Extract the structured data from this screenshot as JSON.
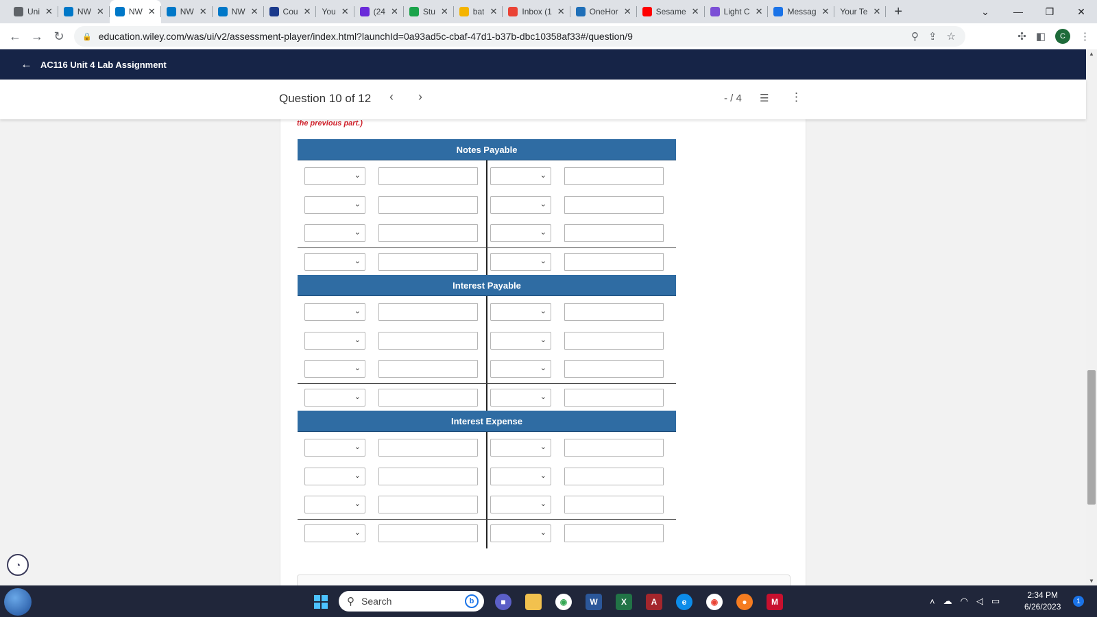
{
  "browser": {
    "tabs": [
      {
        "title": "Uni",
        "icon": "university-icon",
        "color": "#5f6368"
      },
      {
        "title": "NW",
        "icon": "wiley-plus-icon",
        "color": "#0078c8"
      },
      {
        "title": "NW",
        "icon": "wiley-plus-icon",
        "color": "#0078c8",
        "active": true
      },
      {
        "title": "NW",
        "icon": "wiley-plus-icon",
        "color": "#0078c8"
      },
      {
        "title": "NW",
        "icon": "wiley-plus-icon",
        "color": "#0078c8"
      },
      {
        "title": "Cou",
        "icon": "star-shield-icon",
        "color": "#1b3a8c"
      },
      {
        "title": "You",
        "icon": "",
        "color": ""
      },
      {
        "title": "(24",
        "icon": "mail-icon",
        "color": "#6a2bd9"
      },
      {
        "title": "Stu",
        "icon": "study-icon",
        "color": "#1aa34a"
      },
      {
        "title": "bat",
        "icon": "spark-icon",
        "color": "#f4b400"
      },
      {
        "title": "Inbox (1",
        "icon": "gmail-icon",
        "color": "#ea4335"
      },
      {
        "title": "OneHor",
        "icon": "onehome-icon",
        "color": "#1e6fb8"
      },
      {
        "title": "Sesame",
        "icon": "youtube-icon",
        "color": "#ff0000"
      },
      {
        "title": "Light C",
        "icon": "light-icon",
        "color": "#7b4fd6"
      },
      {
        "title": "Messag",
        "icon": "zillow-icon",
        "color": "#1a73e8"
      },
      {
        "title": "Your Te",
        "icon": "",
        "color": ""
      }
    ],
    "url": "education.wiley.com/was/ui/v2/assessment-player/index.html?launchId=0a93ad5c-cbaf-47d1-b37b-dbc10358af33#/question/9",
    "avatar_letter": "C"
  },
  "app": {
    "assignment_title": "AC116 Unit 4 Lab Assignment"
  },
  "question_nav": {
    "label": "Question 10 of 12",
    "score": "- / 4"
  },
  "content": {
    "prev_part_note": "the previous part.)",
    "t_accounts": [
      {
        "title": "Notes Payable",
        "rows": 4
      },
      {
        "title": "Interest Payable",
        "rows": 4
      },
      {
        "title": "Interest Expense",
        "rows": 4
      }
    ]
  },
  "taskbar": {
    "search_placeholder": "Search",
    "time": "2:34 PM",
    "date": "6/26/2023",
    "notification_count": "1"
  }
}
